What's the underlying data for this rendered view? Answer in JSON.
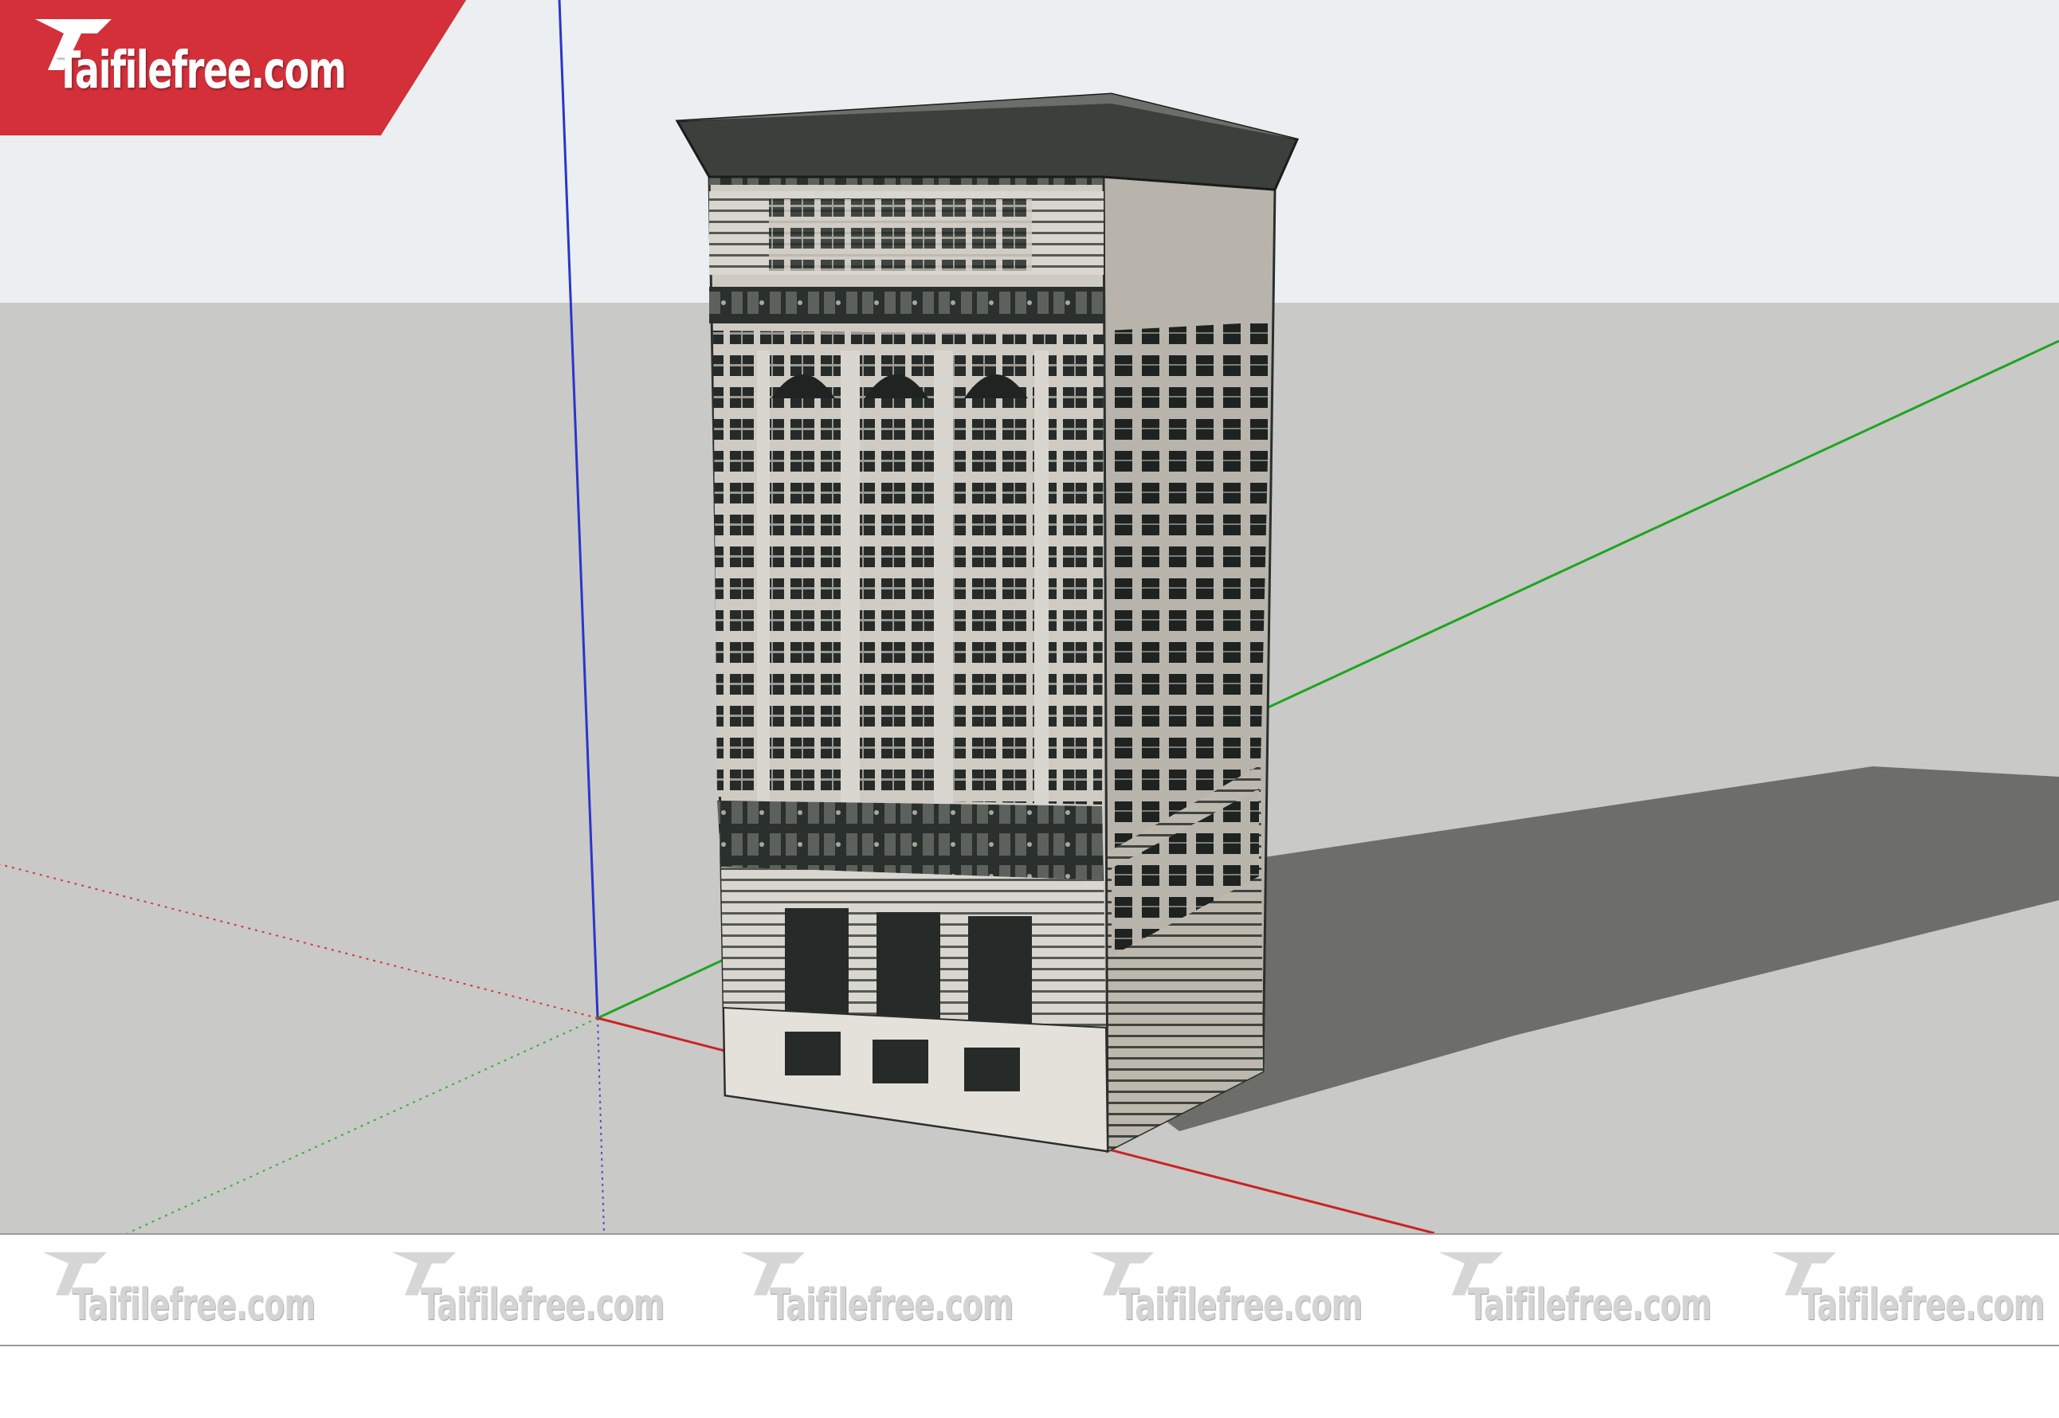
{
  "brand": {
    "logo_text": "Taifilefree.com",
    "banner_color": "#d3303a"
  },
  "scene": {
    "sky_color": "#eceff1",
    "ground_color": "#c9c9c7",
    "shadow_color": "#6d6d69",
    "axes": {
      "blue": "#2a36c8",
      "green": "#1ea51e",
      "red": "#cc2222"
    },
    "model": "classical high-rise building"
  },
  "watermarks": [
    "Taifilefree.com",
    "Taifilefree.com",
    "Taifilefree.com",
    "Taifilefree.com",
    "Taifilefree.com",
    "Taifilefree.com"
  ]
}
